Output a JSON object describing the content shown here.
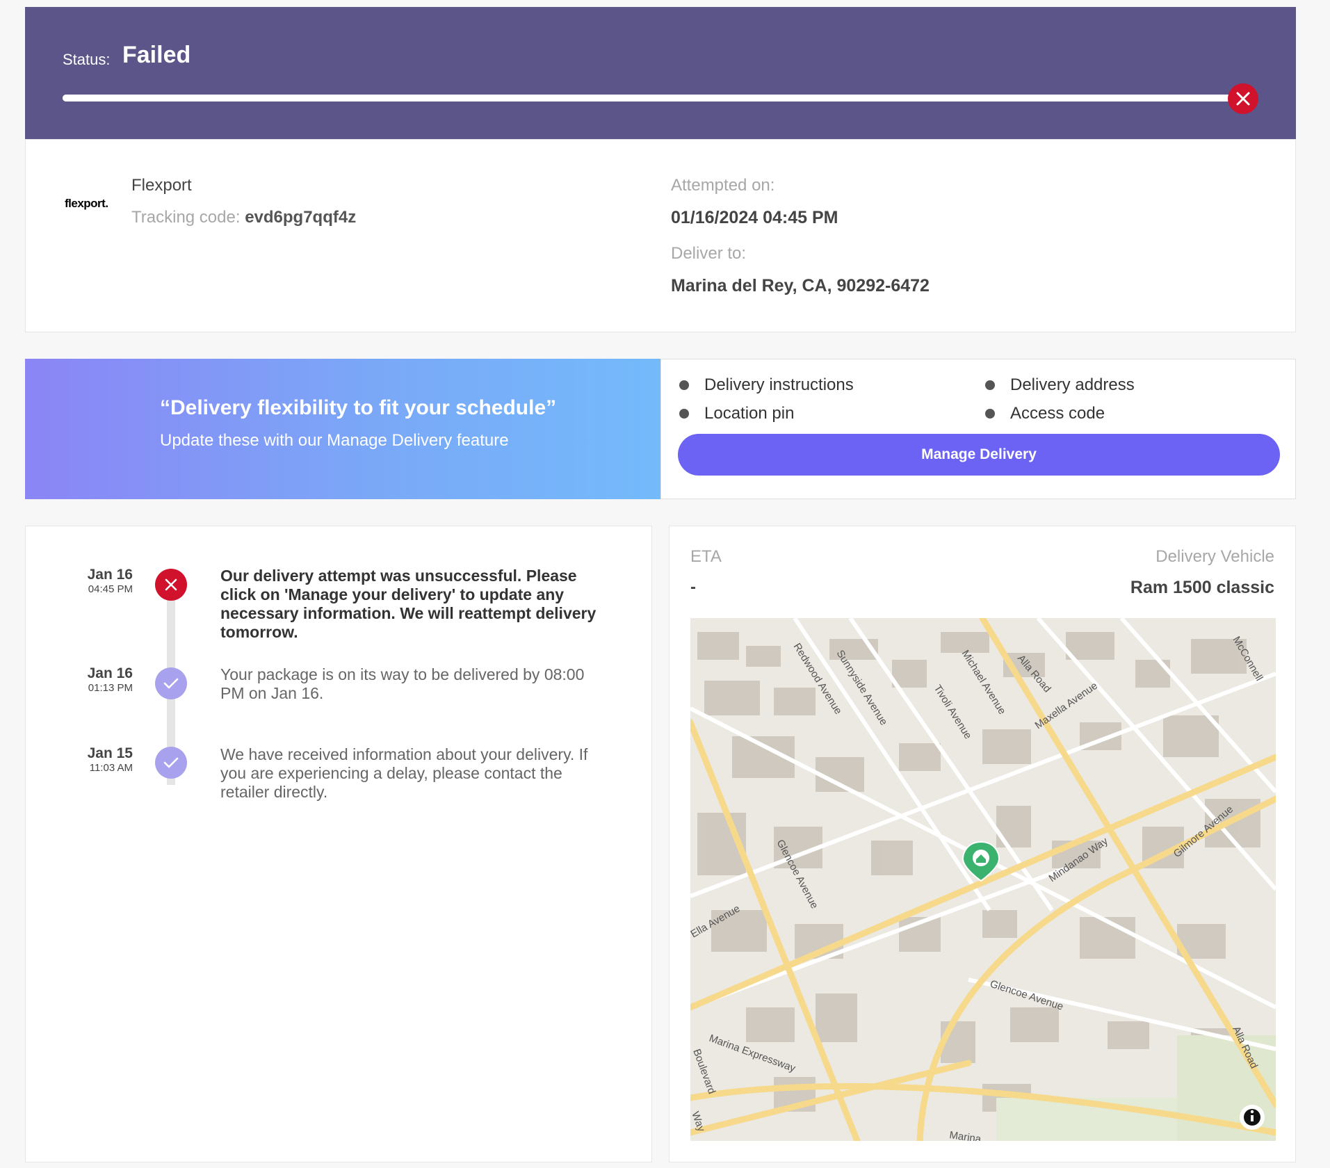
{
  "status": {
    "label": "Status:",
    "value": "Failed",
    "progress_percent": 100
  },
  "carrier": {
    "logo_text": "flexport.",
    "name": "Flexport",
    "tracking_label": "Tracking code:",
    "tracking_code": "evd6pg7qqf4z"
  },
  "attempt": {
    "label": "Attempted on:",
    "value": "01/16/2024 04:45 PM"
  },
  "deliver": {
    "label": "Deliver to:",
    "value": "Marina del Rey, CA, 90292-6472"
  },
  "promo": {
    "quote": "“Delivery flexibility to fit your schedule”",
    "subtitle": "Update these with our Manage Delivery feature"
  },
  "features": [
    "Delivery instructions",
    "Delivery address",
    "Location pin",
    "Access code"
  ],
  "manage_button": "Manage Delivery",
  "timeline": [
    {
      "date": "Jan 16",
      "time": "04:45 PM",
      "text": "Our delivery attempt was unsuccessful. Please click on 'Manage your delivery' to update any necessary information. We will reattempt delivery tomorrow.",
      "state": "failed"
    },
    {
      "date": "Jan 16",
      "time": "01:13 PM",
      "text": "Your package is on its way to be delivered by 08:00 PM on Jan 16.",
      "state": "done"
    },
    {
      "date": "Jan 15",
      "time": "11:03 AM",
      "text": "We have received information about your delivery. If you are experiencing a delay, please contact the retailer directly.",
      "state": "done"
    }
  ],
  "eta": {
    "label": "ETA",
    "value": "-"
  },
  "vehicle": {
    "label": "Delivery Vehicle",
    "value": "Ram 1500 classic"
  },
  "map": {
    "street_labels": [
      "Redwood Avenue",
      "Sunnyside Avenue",
      "Michael Avenue",
      "Tivoli Avenue",
      "Alla Road",
      "Maxella Avenue",
      "McConnell",
      "Glencoe Avenue",
      "Mindanao Way",
      "Gilmore Avenue",
      "Ella Avenue",
      "Marina Expressway",
      "Boulevard",
      "Way",
      "Marina"
    ],
    "pin_icon": "home-pin-icon",
    "info_icon": "info-icon"
  },
  "colors": {
    "header": "#5b5589",
    "fail": "#d0122c",
    "accent": "#6c63f4",
    "done_node": "#a8a2ee",
    "road": "#f6d98a",
    "pin": "#3bb26d"
  }
}
